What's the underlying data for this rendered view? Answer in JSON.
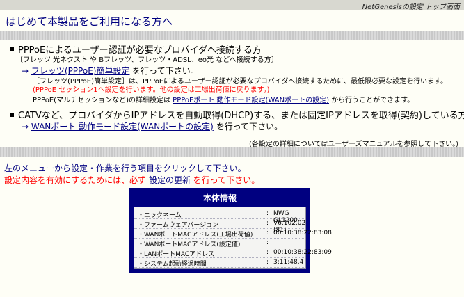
{
  "header": {
    "title": "NetGenesisの設定 トップ画面"
  },
  "page_title": "はじめて本製品をご利用になる方へ",
  "section_pppoe": {
    "heading": "PPPoEによるユーザー認証が必要なプロバイダへ接続する方",
    "subheading": "〔フレッツ 光ネクスト や Bフレッツ、フレッツ・ADSL、eo光 などへ接続する方〕",
    "arrow": "→",
    "link_label": "フレッツ(PPPoE)簡単設定",
    "link_suffix": "を行って下さい。",
    "desc": "［フレッツ(PPPoE)簡単設定］は、PPPoEによるユーザー認証が必要なプロバイダへ接続するために、最低限必要な設定を行います。",
    "note": "(PPPoE セッション1へ設定を行います。他の設定は工場出荷値に戻ります。)",
    "detail_prefix": "PPPoE(マルチセッションなど)の詳細設定は",
    "detail_link": "PPPoEポート 動作モード設定(WANポートの設定)",
    "detail_suffix": "から行うことができます。"
  },
  "section_catv": {
    "heading": "CATVなど、プロバイダからIPアドレスを自動取得(DHCP)する、または固定IPアドレスを取得(契約)している方",
    "arrow": "→",
    "link_label": "WANポート 動作モード設定(WANポートの設定)",
    "link_suffix": "を行って下さい。"
  },
  "manual_note": "(各設定の詳細についてはユーザーズマニュアルを参照して下さい。)",
  "instruction": "左のメニューから設定・作業を行う項目をクリックして下さい。",
  "warning": {
    "prefix": "設定内容を有効にするためには、必ず",
    "link": "設定の更新",
    "suffix": "を行って下さい。"
  },
  "info_panel": {
    "title": "本体情報",
    "rows": [
      {
        "label": "・ニックネーム",
        "colon": ":",
        "value": "NWG GL1200"
      },
      {
        "label": "・ファームウェアバージョン",
        "colon": ":",
        "value": "V6.102.02 (81)"
      },
      {
        "label": "・WANポートMACアドレス(工場出荷値)",
        "colon": ":",
        "value": "00:10:38:22:83:08"
      },
      {
        "label": "・WANポートMACアドレス(設定値)",
        "colon": ":",
        "value": ""
      },
      {
        "label": "・LANポートMACアドレス",
        "colon": ":",
        "value": "00:10:38:22:83:09"
      },
      {
        "label": "・システム起動経過時間",
        "colon": ":",
        "value": "3:11:48.4"
      }
    ]
  }
}
